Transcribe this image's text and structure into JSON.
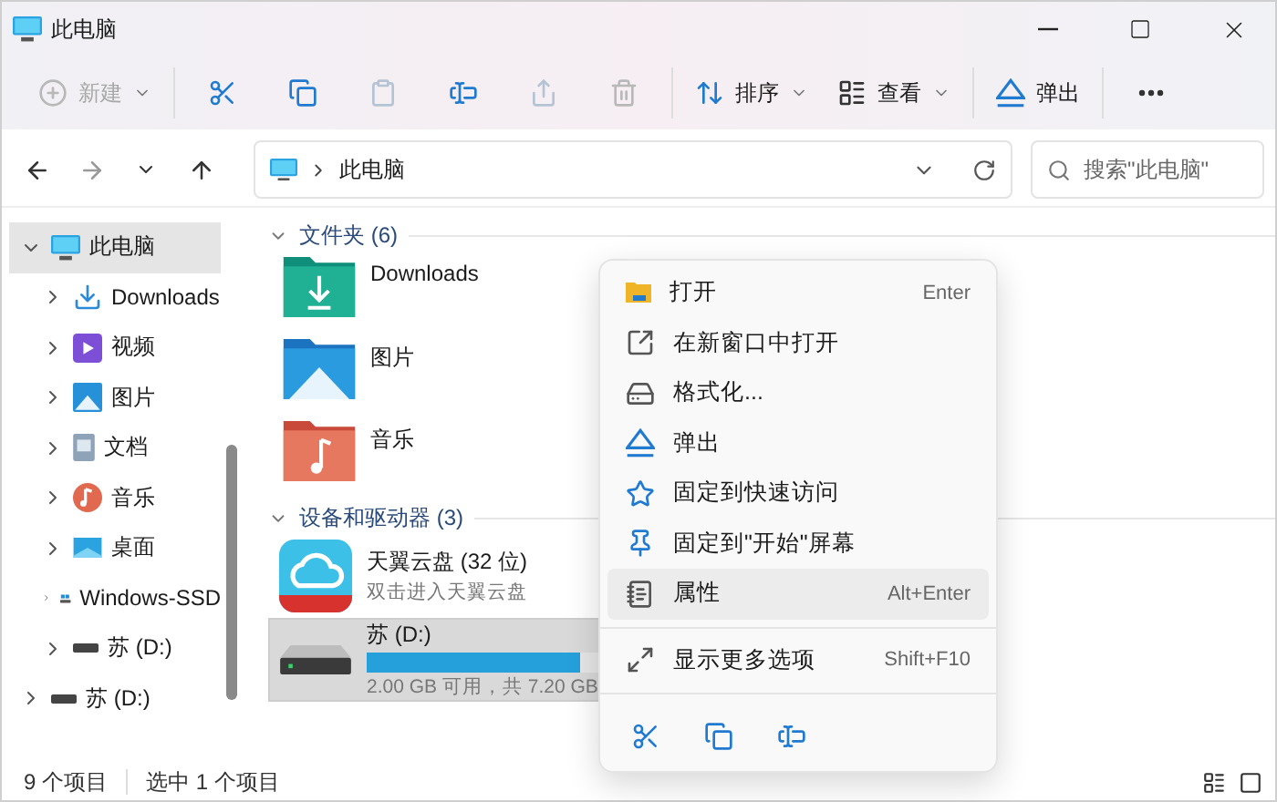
{
  "window": {
    "title": "此电脑"
  },
  "toolbar": [
    {
      "kind": "new",
      "label": "新建",
      "disabled": true,
      "dropdown": true
    },
    {
      "kind": "cut",
      "disabled": false
    },
    {
      "kind": "copy",
      "disabled": false
    },
    {
      "kind": "paste",
      "disabled": true
    },
    {
      "kind": "rename",
      "disabled": false
    },
    {
      "kind": "share",
      "disabled": true
    },
    {
      "kind": "delete",
      "disabled": true
    },
    {
      "kind": "sort",
      "label": "排序",
      "disabled": false,
      "dropdown": true
    },
    {
      "kind": "view",
      "label": "查看",
      "disabled": false,
      "dropdown": true
    },
    {
      "kind": "eject",
      "label": "弹出",
      "disabled": false,
      "dropdown": false
    },
    {
      "kind": "more",
      "disabled": false
    }
  ],
  "address": {
    "path": "此电脑",
    "search_placeholder": "搜索\"此电脑\""
  },
  "sidebar": {
    "items": [
      {
        "label": "此电脑",
        "kind": "pc",
        "expanded": true,
        "selected": true,
        "children": [
          {
            "label": "Downloads",
            "kind": "downloads",
            "expanded": false,
            "selected": false
          },
          {
            "label": "视频",
            "kind": "videos",
            "expanded": false,
            "selected": false
          },
          {
            "label": "图片",
            "kind": "pictures",
            "expanded": false,
            "selected": false
          },
          {
            "label": "文档",
            "kind": "documents",
            "expanded": false,
            "selected": false
          },
          {
            "label": "音乐",
            "kind": "music",
            "expanded": false,
            "selected": false
          },
          {
            "label": "桌面",
            "kind": "desktop",
            "expanded": false,
            "selected": false
          },
          {
            "label": "Windows-SSD",
            "kind": "ssd",
            "expanded": false,
            "selected": false
          },
          {
            "label": "苏 (D:)",
            "kind": "drive",
            "expanded": false,
            "selected": false
          }
        ]
      },
      {
        "label": "苏 (D:)",
        "kind": "drive",
        "expanded": false,
        "selected": false
      }
    ]
  },
  "folders": {
    "title": "文件夹 (6)",
    "items": [
      {
        "name": "Downloads",
        "kind": "downloads"
      },
      {
        "name": "图片",
        "kind": "pictures"
      },
      {
        "name": "音乐",
        "kind": "music"
      }
    ]
  },
  "drives": {
    "title": "设备和驱动器 (3)",
    "items": [
      {
        "kind": "cloud",
        "name": "天翼云盘 (32 位)",
        "subtitle": "双击进入天翼云盘",
        "selected": false
      },
      {
        "kind": "disk",
        "name": "苏 (D:)",
        "level": 0.72,
        "info": "2.00 GB 可用，共 7.20 GB",
        "selected": true
      }
    ]
  },
  "context_menu": {
    "items": [
      {
        "kind": "open",
        "label": "打开",
        "shortcut": "Enter",
        "highlighted": false
      },
      {
        "kind": "new-window",
        "label": "在新窗口中打开",
        "highlighted": false
      },
      {
        "kind": "format",
        "label": "格式化...",
        "highlighted": false
      },
      {
        "kind": "eject",
        "label": "弹出",
        "highlighted": false
      },
      {
        "kind": "star",
        "label": "固定到快速访问",
        "highlighted": false
      },
      {
        "kind": "pin",
        "label": "固定到\"开始\"屏幕",
        "highlighted": false
      },
      {
        "kind": "properties",
        "label": "属性",
        "shortcut": "Alt+Enter",
        "highlighted": true,
        "separator_after": true
      },
      {
        "kind": "more",
        "label": "显示更多选项",
        "shortcut": "Shift+F10",
        "highlighted": false,
        "separator_after": true
      }
    ],
    "actions": [
      {
        "kind": "cut"
      },
      {
        "kind": "copy"
      },
      {
        "kind": "rename"
      }
    ]
  },
  "status_bar": [
    "9 个项目",
    "选中 1 个项目"
  ]
}
